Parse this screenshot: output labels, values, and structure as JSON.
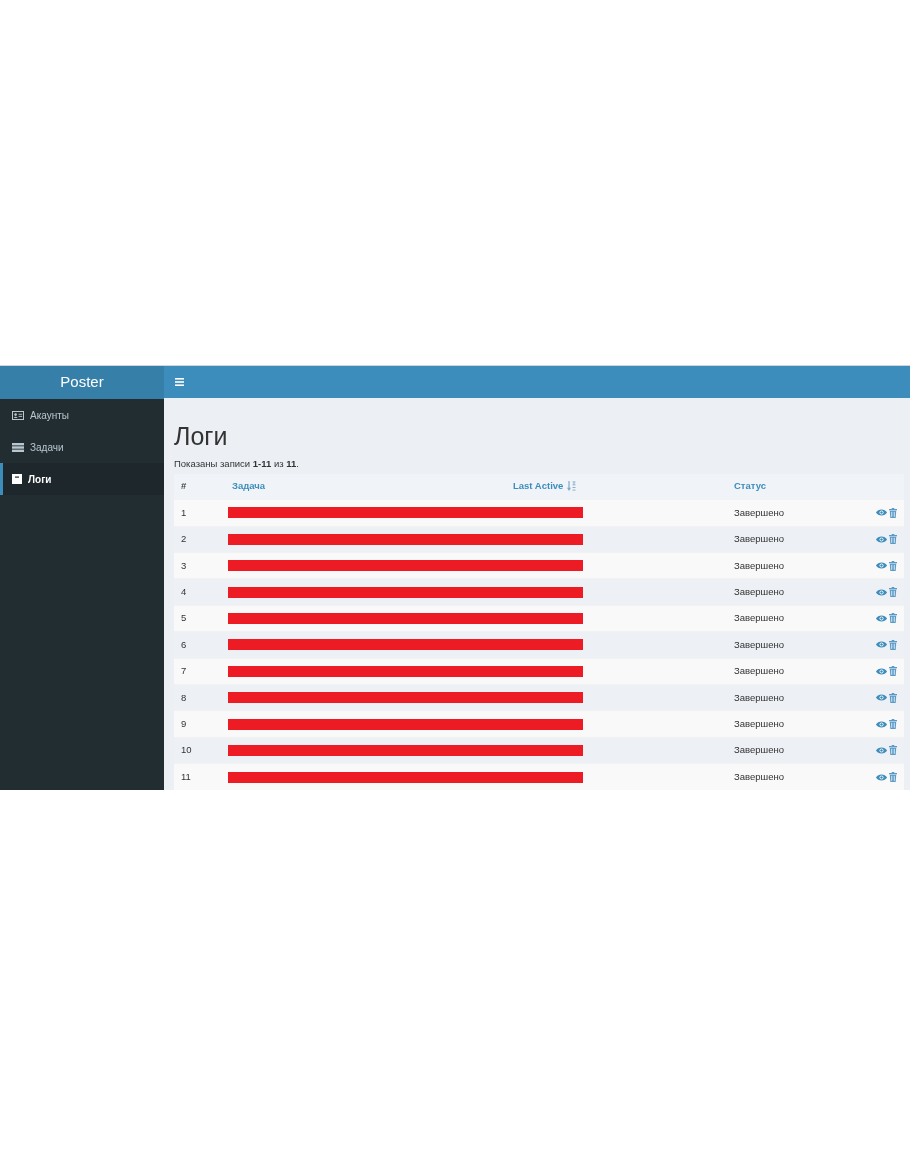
{
  "brand": "Poster",
  "sidebar": {
    "items": [
      {
        "kind": "accounts",
        "label": "Акаунты",
        "selected": false
      },
      {
        "kind": "tasks",
        "label": "Задачи",
        "selected": false
      },
      {
        "kind": "logs",
        "label": "Логи",
        "selected": true
      }
    ]
  },
  "page": {
    "title": "Логи",
    "summary": "Показаны записи **1-11** из **11**."
  },
  "table": {
    "columns": [
      {
        "label": "#",
        "sortable": false
      },
      {
        "label": "Задача",
        "sortable": true,
        "sorted": false
      },
      {
        "label": "Last Active",
        "sortable": true,
        "sorted": true
      },
      {
        "label": "Статус",
        "sortable": true,
        "sorted": false
      }
    ],
    "rows": [
      {
        "number": "1",
        "redacted": true,
        "status": "Завершено"
      },
      {
        "number": "2",
        "redacted": true,
        "status": "Завершено"
      },
      {
        "number": "3",
        "redacted": true,
        "status": "Завершено"
      },
      {
        "number": "4",
        "redacted": true,
        "status": "Завершено"
      },
      {
        "number": "5",
        "redacted": true,
        "status": "Завершено"
      },
      {
        "number": "6",
        "redacted": true,
        "status": "Завершено"
      },
      {
        "number": "7",
        "redacted": true,
        "status": "Завершено"
      },
      {
        "number": "8",
        "redacted": true,
        "status": "Завершено"
      },
      {
        "number": "9",
        "redacted": true,
        "status": "Завершено"
      },
      {
        "number": "10",
        "redacted": true,
        "status": "Завершено"
      },
      {
        "number": "11",
        "redacted": true,
        "status": "Завершено"
      }
    ]
  }
}
